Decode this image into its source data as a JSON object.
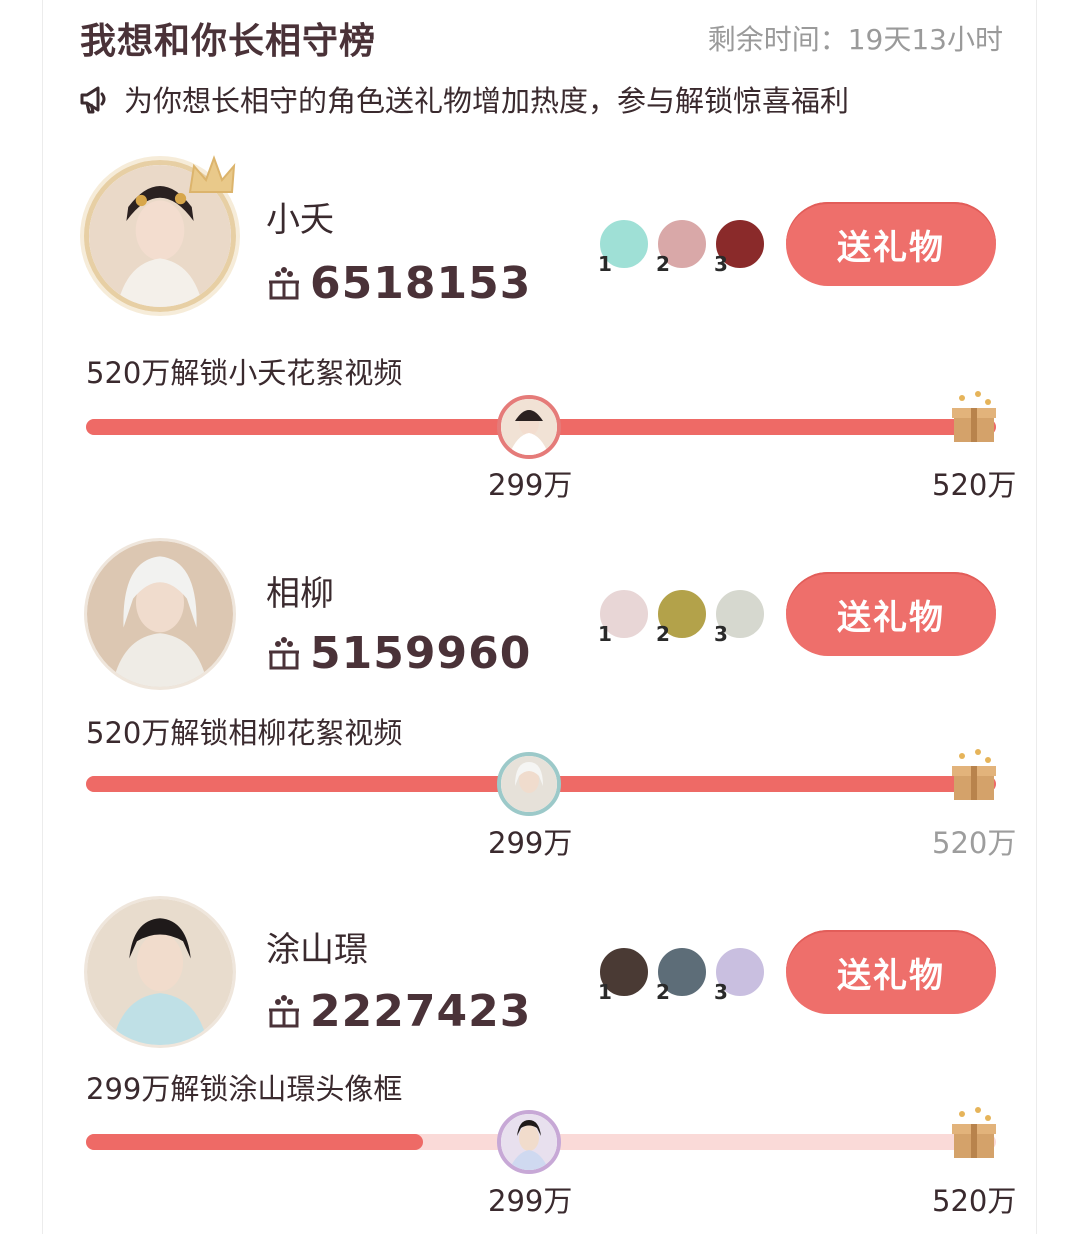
{
  "header": {
    "title": "我想和你长相守榜",
    "remaining": "剩余时间：19天13小时",
    "notice": "为你想长相守的角色送礼物增加热度，参与解锁惊喜福利"
  },
  "entries": [
    {
      "name": "小夭",
      "score": "6518153",
      "fans": [
        "1",
        "2",
        "3"
      ],
      "button": "送礼物",
      "unlock": "520万解锁小夭花絮视频",
      "progress": 1.0,
      "mark_label": "299万",
      "end_label": "520万"
    },
    {
      "name": "相柳",
      "score": "5159960",
      "fans": [
        "1",
        "2",
        "3"
      ],
      "button": "送礼物",
      "unlock": "520万解锁相柳花絮视频",
      "progress": 1.0,
      "mark_label": "299万",
      "end_label": "520万"
    },
    {
      "name": "涂山璟",
      "score": "2227423",
      "fans": [
        "1",
        "2",
        "3"
      ],
      "button": "送礼物",
      "unlock": "299万解锁涂山璟头像框",
      "progress": 0.37,
      "mark_label": "299万",
      "end_label": "520万"
    }
  ],
  "colors": {
    "accent": "#ee6f6b",
    "track_bg": "#fadad8",
    "title": "#4a3238",
    "muted": "#9a9a9a"
  },
  "icons": [
    "megaphone-icon",
    "crown-icon",
    "gift-icon",
    "gift-box-icon"
  ]
}
